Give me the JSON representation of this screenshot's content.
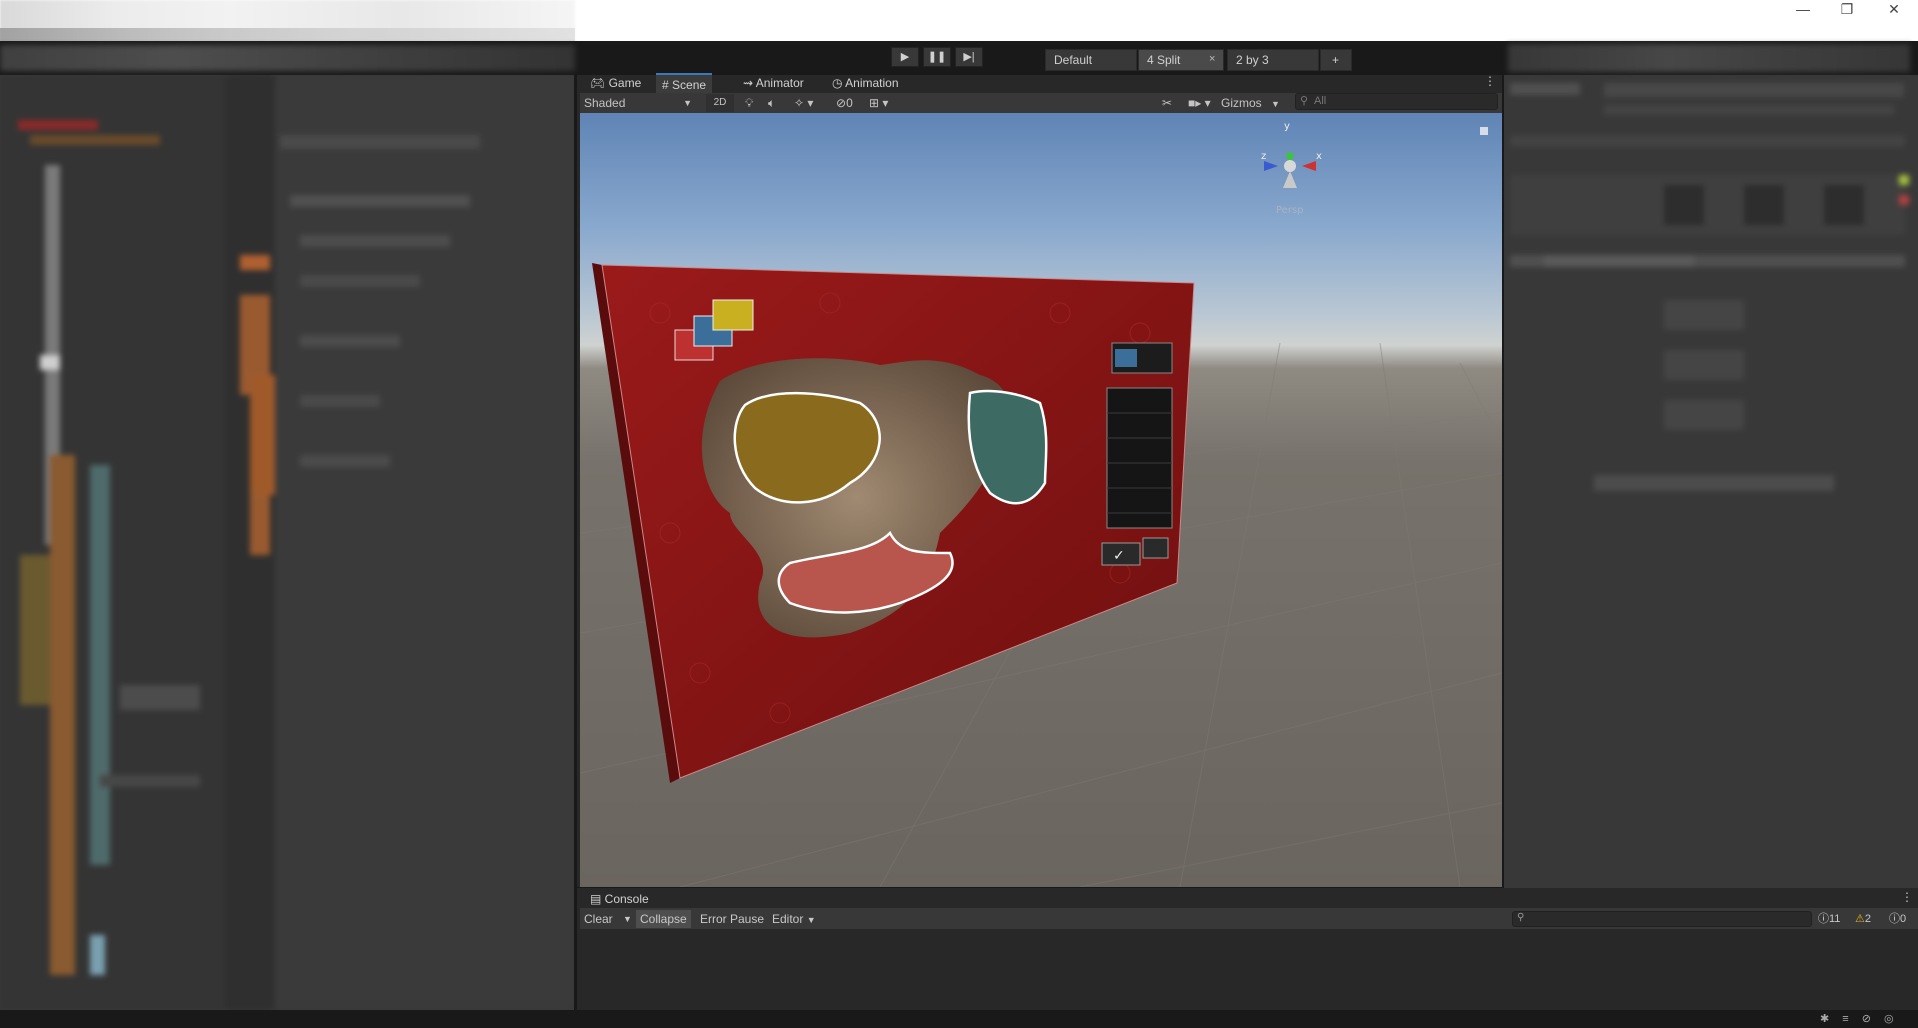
{
  "window": {
    "controls": {
      "minimize": "—",
      "restore": "❐",
      "close": "✕"
    }
  },
  "toolbar": {
    "play": "▶",
    "pause": "❚❚",
    "step": "▶|",
    "layouts": [
      {
        "label": "Default"
      },
      {
        "label": "4 Split",
        "close": "×"
      },
      {
        "label": "2 by 3"
      }
    ],
    "add_layout": "+"
  },
  "scene_panel": {
    "tabs": [
      {
        "label": "Game",
        "icon": "gamepad-icon"
      },
      {
        "label": "Scene",
        "icon": "grid-icon"
      },
      {
        "label": "Animator",
        "icon": "animator-icon"
      },
      {
        "label": "Animation",
        "icon": "clock-icon"
      }
    ],
    "menu": "⋮",
    "shading_mode": "Shaded",
    "mode_2d": "2D",
    "hidden_count": "0",
    "gizmos_label": "Gizmos",
    "search_placeholder": "All",
    "gizmo_axes": {
      "y": "y",
      "x": "x",
      "z": "z",
      "projection": "Persp"
    }
  },
  "console": {
    "tab_label": "Console",
    "menu": "⋮",
    "buttons": {
      "clear": "Clear",
      "collapse": "Collapse",
      "error_pause": "Error Pause",
      "editor": "Editor"
    },
    "counts": {
      "logs": "11",
      "warnings": "2",
      "errors": "0"
    }
  },
  "colors": {
    "panel_bg": "#383838",
    "dark_bg": "#191919",
    "accent_blue": "#3a79bb",
    "wall_red": "#8b1414",
    "region_gold": "#8a6a1c",
    "region_teal": "#3d6a62",
    "region_salmon": "#b8564e"
  }
}
